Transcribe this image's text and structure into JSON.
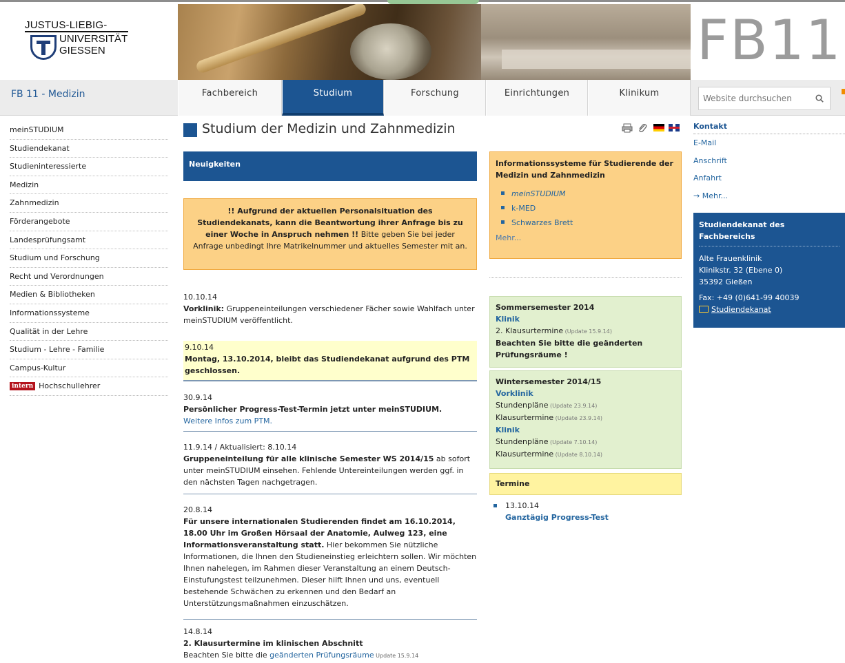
{
  "header": {
    "logo_line1": "JUSTUS-LIEBIG-",
    "logo_line2": "UNIVERSITÄT",
    "logo_line3": "GIESSEN",
    "fb_label": "FB11"
  },
  "nav": {
    "site_name": "FB 11 - Medizin",
    "tabs": [
      {
        "label": "Fachbereich"
      },
      {
        "label": "Studium"
      },
      {
        "label": "Forschung"
      },
      {
        "label": "Einrichtungen"
      },
      {
        "label": "Klinikum"
      }
    ],
    "search_placeholder": "Website durchsuchen"
  },
  "sidebar": {
    "items": [
      {
        "label": "meinSTUDIUM"
      },
      {
        "label": "Studiendekanat"
      },
      {
        "label": "Studieninteressierte"
      },
      {
        "label": "Medizin"
      },
      {
        "label": "Zahnmedizin"
      },
      {
        "label": "Förderangebote"
      },
      {
        "label": "Landesprüfungsamt"
      },
      {
        "label": "Studium und Forschung"
      },
      {
        "label": "Recht und Verordnungen"
      },
      {
        "label": "Medien & Bibliotheken"
      },
      {
        "label": "Informationssysteme"
      },
      {
        "label": "Qualität in der Lehre"
      },
      {
        "label": "Studium - Lehre - Familie"
      },
      {
        "label": "Campus-Kultur"
      },
      {
        "label": "Hochschullehrer",
        "badge": "intern"
      }
    ]
  },
  "main": {
    "page_title": "Studium der Medizin und Zahnmedizin",
    "news_heading": "Neuigkeiten",
    "notice_bold": "!! Aufgrund der aktuellen Personalsituation des Studiendekanats, kann die Beantwortung ihrer Anfrage bis zu einer Woche in Anspruch nehmen !!",
    "notice_text": " Bitte geben Sie bei jeder Anfrage unbedingt Ihre Matrikelnummer und aktuelles Semester mit an.",
    "news": [
      {
        "date": "10.10.14",
        "bold": "Vorklinik:",
        "text": " Gruppeneinteilungen verschiedener Fächer sowie Wahlfach unter meinSTUDIUM veröffentlicht."
      },
      {
        "date": "9.10.14",
        "bold": "Montag, 13.10.2014, bleibt das Studiendekanat aufgrund des PTM geschlossen."
      },
      {
        "date": "30.9.14",
        "bold": "Persönlicher Progress-Test-Termin jetzt unter meinSTUDIUM.",
        "link": "Weitere Infos zum PTM."
      },
      {
        "date": "11.9.14 / Aktualisiert: 8.10.14",
        "bold": "Gruppeneinteilung für alle klinische Semester WS 2014/15",
        "text": " ab sofort unter meinSTUDIUM einsehen. Fehlende Untereinteilungen werden ggf. in den nächsten Tagen nachgetragen."
      },
      {
        "date": "20.8.14",
        "bold": "Für unsere internationalen Studierenden findet am 16.10.2014, 18.00 Uhr im Großen Hörsaal der Anatomie, Aulweg 123, eine Informationsveranstaltung statt.",
        "text": " Hier bekommen Sie nützliche Informationen, die Ihnen den Studieneinstieg erleichtern sollen. Wir möchten Ihnen nahelegen, im Rahmen dieser Veranstaltung an einem Deutsch-Einstufungstest teilzunehmen. Dieser hilft Ihnen und uns, eventuell bestehende Schwächen zu erkennen und den Bedarf an Unterstützungsmaßnahmen einzuschätzen."
      },
      {
        "date": "14.8.14",
        "bold": "2. Klausurtermine im klinischen Abschnitt",
        "pre": "Beachten Sie bitte die ",
        "link": "geänderten Prüfungsräume",
        "small": " Update 15.9.14"
      }
    ]
  },
  "info_box": {
    "title": "Informationssysteme für Studierende der Medizin und Zahnmedizin",
    "links": [
      "meinSTUDIUM",
      "k-MED",
      "Schwarzes Brett"
    ],
    "more": "Mehr..."
  },
  "sommersemester": {
    "heading": "Sommersemester 2014",
    "sub": "Klinik",
    "line1": "2. Klausurtermine",
    "line1_update": " (Update 15.9.14)",
    "note": "Beachten Sie bitte die geänderten Prüfungsräume !"
  },
  "wintersemester": {
    "heading": "Wintersemester 2014/15",
    "sub1": "Vorklinik",
    "l1": "Stundenpläne",
    "l1u": " (Update 23.9.14)",
    "l2": "Klausurtermine",
    "l2u": " (Update 23.9.14)",
    "sub2": "Klinik",
    "l3": "Stundenpläne",
    "l3u": " (Update 7.10.14)",
    "l4": "Klausurtermine",
    "l4u": " (Update 8.10.14)"
  },
  "termine": {
    "heading": "Termine",
    "date": "13.10.14",
    "title": "Ganztägig Progress-Test"
  },
  "kontakt": {
    "heading": "Kontakt",
    "links": [
      "E-Mail",
      "Anschrift",
      "Anfahrt",
      "→ Mehr..."
    ]
  },
  "dekanat": {
    "heading": "Studiendekanat des Fachbereichs",
    "addr1": "Alte Frauenklinik",
    "addr2": "Klinikstr. 32 (Ebene 0)",
    "addr3": "35392 Gießen",
    "fax": "Fax: +49 (0)641-99 40039",
    "mail": "Studiendekanat"
  },
  "colors": {
    "primary_blue": "#1c5592",
    "notice_orange": "#fcd186",
    "green_box": "#e2f0cf",
    "termine_yellow": "#fff3a0",
    "intern_badge": "#b4121b"
  }
}
